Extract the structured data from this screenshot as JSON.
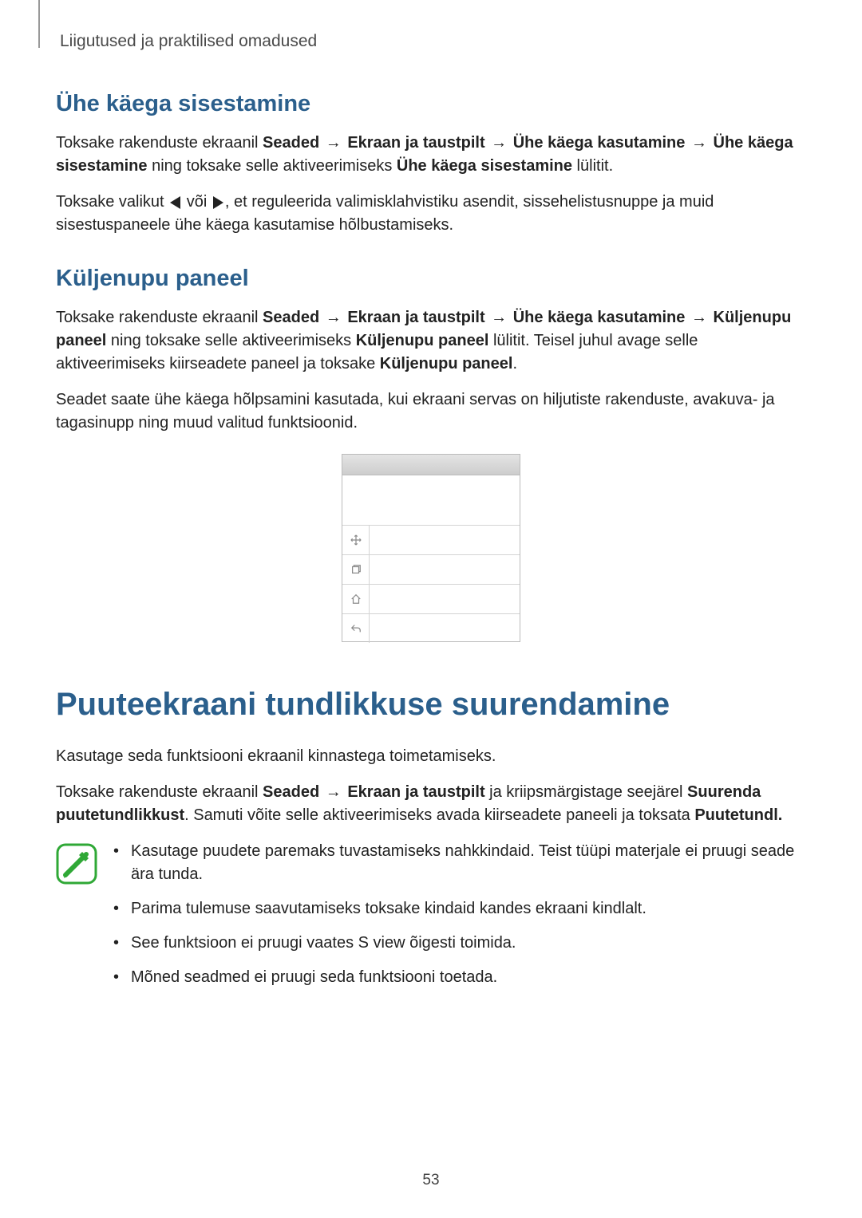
{
  "header": {
    "breadcrumb": "Liigutused ja praktilised omadused"
  },
  "section1": {
    "heading": "Ühe käega sisestamine",
    "p1_pre": "Toksake rakenduste ekraanil ",
    "p1_b1": "Seaded",
    "p1_arrow": " → ",
    "p1_b2": "Ekraan ja taustpilt",
    "p1_b3": "Ühe käega kasutamine",
    "p1_b4": "Ühe käega sisestamine",
    "p1_mid": " ning toksake selle aktiveerimiseks ",
    "p1_b5": "Ühe käega sisestamine",
    "p1_end": " lülitit.",
    "p2_pre": "Toksake valikut ",
    "p2_mid": " või ",
    "p2_post": ", et reguleerida valimisklahvistiku asendit, sissehelistusnuppe ja muid sisestuspaneele ühe käega kasutamise hõlbustamiseks."
  },
  "section2": {
    "heading": "Küljenupu paneel",
    "p1_pre": "Toksake rakenduste ekraanil ",
    "p1_b1": "Seaded",
    "p1_arrow": " → ",
    "p1_b2": "Ekraan ja taustpilt",
    "p1_b3": "Ühe käega kasutamine",
    "p1_b4": "Küljenupu paneel",
    "p1_mid": " ning toksake selle aktiveerimiseks ",
    "p1_b5": "Küljenupu paneel",
    "p1_post": " lülitit. Teisel juhul avage selle aktiveerimiseks kiirseadete paneel ja toksake ",
    "p1_b6": "Küljenupu paneel",
    "p1_end": ".",
    "p2": "Seadet saate ühe käega hõlpsamini kasutada, kui ekraani servas on hiljutiste rakenduste, avakuva- ja tagasinupp ning muud valitud funktsioonid."
  },
  "section3": {
    "title": "Puuteekraani tundlikkuse suurendamine",
    "p1": "Kasutage seda funktsiooni ekraanil kinnastega toimetamiseks.",
    "p2_pre": "Toksake rakenduste ekraanil ",
    "p2_b1": "Seaded",
    "p2_arrow": " → ",
    "p2_b2": "Ekraan ja taustpilt",
    "p2_mid": " ja kriipsmärgistage seejärel ",
    "p2_b3": "Suurenda puutetundlikkust",
    "p2_post": ". Samuti võite selle aktiveerimiseks avada kiirseadete paneeli ja toksata ",
    "p2_b4": "Puutetundl.",
    "notes": [
      "Kasutage puudete paremaks tuvastamiseks nahkkindaid. Teist tüüpi materjale ei pruugi seade ära tunda.",
      "Parima tulemuse saavutamiseks toksake kindaid kandes ekraani kindlalt.",
      "See funktsioon ei pruugi vaates S view õigesti toimida.",
      "Mõned seadmed ei pruugi seda funktsiooni toetada."
    ]
  },
  "page_number": "53"
}
